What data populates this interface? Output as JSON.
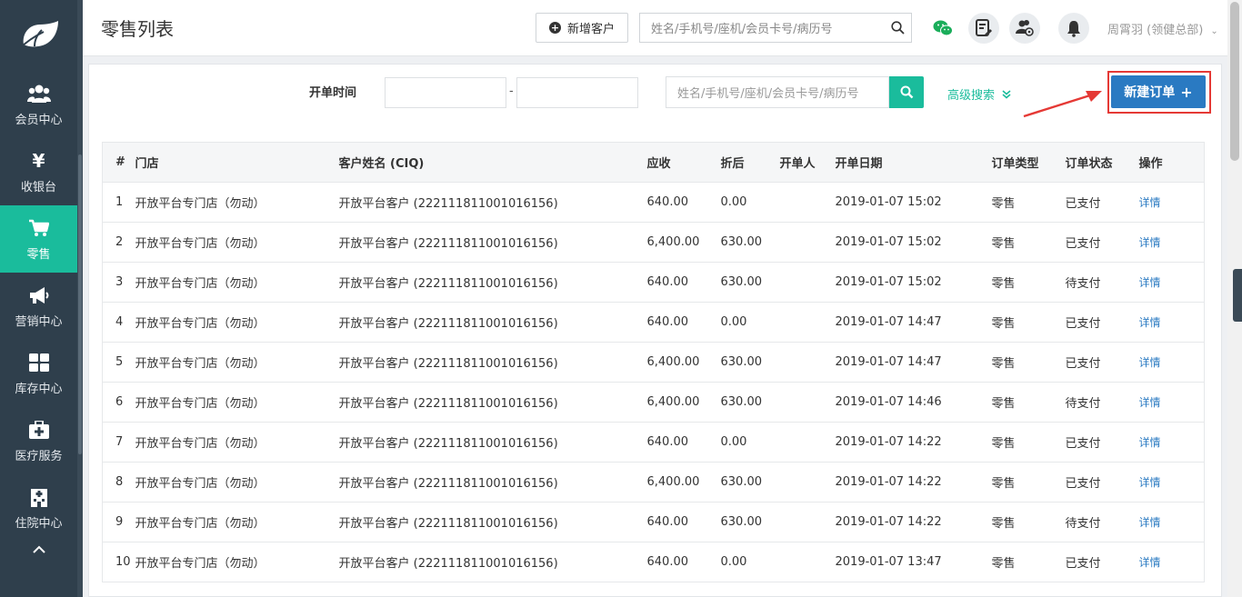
{
  "sidebar": {
    "items": [
      {
        "label": "会员中心",
        "icon": "members-icon",
        "active": false
      },
      {
        "label": "收银台",
        "icon": "yen-icon",
        "active": false
      },
      {
        "label": "零售",
        "icon": "cart-icon",
        "active": true
      },
      {
        "label": "营销中心",
        "icon": "megaphone-icon",
        "active": false
      },
      {
        "label": "库存中心",
        "icon": "grid-icon",
        "active": false
      },
      {
        "label": "医疗服务",
        "icon": "medkit-icon",
        "active": false
      },
      {
        "label": "住院中心",
        "icon": "hospital-icon",
        "active": false
      }
    ]
  },
  "header": {
    "title": "零售列表",
    "add_customer_label": "新增客户",
    "search_placeholder": "姓名/手机号/座机/会员卡号/病历号",
    "user": "周霄羽 (领健总部)"
  },
  "filters": {
    "date_label": "开单时间",
    "date_separator": "-",
    "search_placeholder": "姓名/手机号/座机/会员卡号/病历号",
    "advanced_label": "高级搜索",
    "new_order_label": "新建订单"
  },
  "table": {
    "headers": [
      "#",
      "门店",
      "客户姓名 (CIQ)",
      "应收",
      "折后",
      "开单人",
      "开单日期",
      "订单类型",
      "订单状态",
      "操作"
    ],
    "rows": [
      {
        "idx": "1",
        "store": "开放平台专门店（勿动）",
        "customer": "开放平台客户 (222111811001016156)",
        "receivable": "640.00",
        "discounted": "0.00",
        "creator": "",
        "date": "2019-01-07 15:02",
        "type": "零售",
        "status": "已支付",
        "action": "详情"
      },
      {
        "idx": "2",
        "store": "开放平台专门店（勿动）",
        "customer": "开放平台客户 (222111811001016156)",
        "receivable": "6,400.00",
        "discounted": "630.00",
        "creator": "",
        "date": "2019-01-07 15:02",
        "type": "零售",
        "status": "已支付",
        "action": "详情"
      },
      {
        "idx": "3",
        "store": "开放平台专门店（勿动）",
        "customer": "开放平台客户 (222111811001016156)",
        "receivable": "640.00",
        "discounted": "630.00",
        "creator": "",
        "date": "2019-01-07 15:02",
        "type": "零售",
        "status": "待支付",
        "action": "详情"
      },
      {
        "idx": "4",
        "store": "开放平台专门店（勿动）",
        "customer": "开放平台客户 (222111811001016156)",
        "receivable": "640.00",
        "discounted": "0.00",
        "creator": "",
        "date": "2019-01-07 14:47",
        "type": "零售",
        "status": "已支付",
        "action": "详情"
      },
      {
        "idx": "5",
        "store": "开放平台专门店（勿动）",
        "customer": "开放平台客户 (222111811001016156)",
        "receivable": "6,400.00",
        "discounted": "630.00",
        "creator": "",
        "date": "2019-01-07 14:47",
        "type": "零售",
        "status": "已支付",
        "action": "详情"
      },
      {
        "idx": "6",
        "store": "开放平台专门店（勿动）",
        "customer": "开放平台客户 (222111811001016156)",
        "receivable": "6,400.00",
        "discounted": "630.00",
        "creator": "",
        "date": "2019-01-07 14:46",
        "type": "零售",
        "status": "待支付",
        "action": "详情"
      },
      {
        "idx": "7",
        "store": "开放平台专门店（勿动）",
        "customer": "开放平台客户 (222111811001016156)",
        "receivable": "640.00",
        "discounted": "0.00",
        "creator": "",
        "date": "2019-01-07 14:22",
        "type": "零售",
        "status": "已支付",
        "action": "详情"
      },
      {
        "idx": "8",
        "store": "开放平台专门店（勿动）",
        "customer": "开放平台客户 (222111811001016156)",
        "receivable": "6,400.00",
        "discounted": "630.00",
        "creator": "",
        "date": "2019-01-07 14:22",
        "type": "零售",
        "status": "已支付",
        "action": "详情"
      },
      {
        "idx": "9",
        "store": "开放平台专门店（勿动）",
        "customer": "开放平台客户 (222111811001016156)",
        "receivable": "640.00",
        "discounted": "630.00",
        "creator": "",
        "date": "2019-01-07 14:22",
        "type": "零售",
        "status": "待支付",
        "action": "详情"
      },
      {
        "idx": "10",
        "store": "开放平台专门店（勿动）",
        "customer": "开放平台客户 (222111811001016156)",
        "receivable": "640.00",
        "discounted": "0.00",
        "creator": "",
        "date": "2019-01-07 13:47",
        "type": "零售",
        "status": "已支付",
        "action": "详情"
      }
    ]
  },
  "colors": {
    "sidebar_bg": "#2f3f4c",
    "accent": "#1abc9c",
    "primary": "#2a7ac2",
    "annotation": "#e53935"
  }
}
